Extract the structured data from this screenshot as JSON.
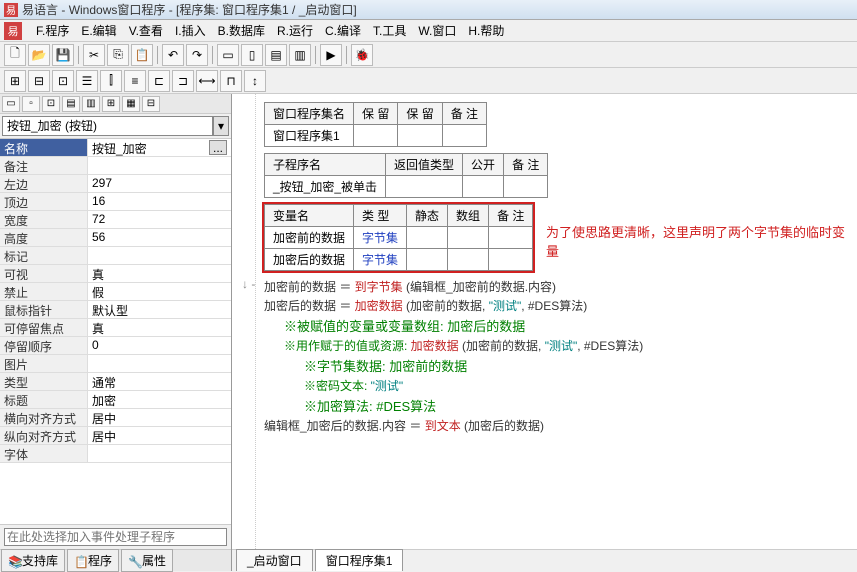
{
  "title": {
    "app": "易语言",
    "window": "Windows窗口程序",
    "context": "[程序集: 窗口程序集1 / _启动窗口]"
  },
  "menu": {
    "items": [
      "F.程序",
      "E.编辑",
      "V.查看",
      "I.插入",
      "B.数据库",
      "R.运行",
      "C.编译",
      "T.工具",
      "W.窗口",
      "H.帮助"
    ]
  },
  "left": {
    "dropdown": "按钮_加密 (按钮)",
    "header": "名称",
    "header_val": "按钮_加密",
    "props": [
      {
        "name": "备注",
        "val": ""
      },
      {
        "name": "左边",
        "val": "297"
      },
      {
        "name": "顶边",
        "val": "16"
      },
      {
        "name": "宽度",
        "val": "72"
      },
      {
        "name": "高度",
        "val": "56"
      },
      {
        "name": "标记",
        "val": ""
      },
      {
        "name": "可视",
        "val": "真"
      },
      {
        "name": "禁止",
        "val": "假"
      },
      {
        "name": "鼠标指针",
        "val": "默认型"
      },
      {
        "name": "可停留焦点",
        "val": "真"
      },
      {
        "name": "  停留顺序",
        "val": "0"
      },
      {
        "name": "图片",
        "val": ""
      },
      {
        "name": "类型",
        "val": "通常"
      },
      {
        "name": "标题",
        "val": "加密"
      },
      {
        "name": "横向对齐方式",
        "val": "居中"
      },
      {
        "name": "纵向对齐方式",
        "val": "居中"
      },
      {
        "name": "字体",
        "val": ""
      }
    ],
    "event_placeholder": "在此处选择加入事件处理子程序",
    "tabs": [
      "支持库",
      "程序",
      "属性"
    ]
  },
  "code": {
    "table1": {
      "headers": [
        "窗口程序集名",
        "保 留",
        "保 留",
        "备 注"
      ],
      "row": [
        "窗口程序集1",
        "",
        "",
        ""
      ]
    },
    "table2": {
      "headers": [
        "子程序名",
        "返回值类型",
        "公开",
        "备 注"
      ],
      "row": [
        "_按钮_加密_被单击",
        "",
        "",
        ""
      ]
    },
    "table3": {
      "headers": [
        "变量名",
        "类 型",
        "静态",
        "数组",
        "备 注"
      ],
      "rows": [
        [
          "加密前的数据",
          "字节集",
          "",
          "",
          ""
        ],
        [
          "加密后的数据",
          "字节集",
          "",
          "",
          ""
        ]
      ]
    },
    "annotation": "为了使思路更清晰，这里声明了两个字节集的临时变量",
    "lines": {
      "l1a": "加密前的数据 ＝ ",
      "l1b": "到字节集",
      "l1c": " (编辑框_加密前的数据.内容)",
      "l2a": "加密后的数据 ＝ ",
      "l2b": "加密数据",
      "l2c": " (加密前的数据, ",
      "l2d": "\"测试\"",
      "l2e": ", #DES算法)",
      "c1": "※被赋值的变量或变量数组:   加密后的数据",
      "c2a": "※用作赋于的值或资源:   ",
      "c2b": "加密数据",
      "c2c": " (加密前的数据, ",
      "c2d": "\"测试\"",
      "c2e": ", #DES算法)",
      "c3": "※字节集数据:   加密前的数据",
      "c4a": "※密码文本:   ",
      "c4b": "\"测试\"",
      "c5": "※加密算法:   #DES算法",
      "l3a": "编辑框_加密后的数据.内容 ＝ ",
      "l3b": "到文本",
      "l3c": " (加密后的数据)"
    }
  },
  "doc_tabs": [
    "_启动窗口",
    "窗口程序集1"
  ]
}
